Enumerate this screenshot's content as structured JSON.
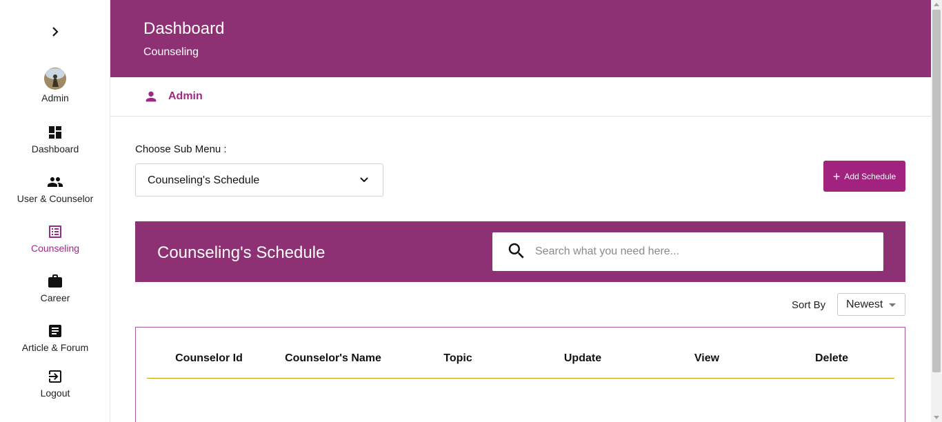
{
  "sidebar": {
    "toggle_icon": "chevron-right-icon",
    "items": [
      {
        "label": "Admin",
        "icon": "avatar"
      },
      {
        "label": "Dashboard",
        "icon": "dashboard-icon"
      },
      {
        "label": "User & Counselor",
        "icon": "people-icon"
      },
      {
        "label": "Counseling",
        "icon": "list-alt-icon",
        "active": true
      },
      {
        "label": "Career",
        "icon": "briefcase-icon"
      },
      {
        "label": "Article & Forum",
        "icon": "article-icon"
      },
      {
        "label": "Logout",
        "icon": "logout-icon"
      }
    ]
  },
  "header": {
    "title": "Dashboard",
    "subtitle": "Counseling"
  },
  "user": {
    "name": "Admin",
    "icon": "person-icon"
  },
  "submenu": {
    "label": "Choose Sub Menu :",
    "selected": "Counseling's Schedule"
  },
  "add_button": {
    "label": "Add Schedule"
  },
  "banner": {
    "title": "Counseling's Schedule",
    "search_placeholder": "Search what you need here..."
  },
  "sort": {
    "label": "Sort By",
    "selected": "Newest"
  },
  "table": {
    "columns": [
      "Counselor Id",
      "Counselor's Name",
      "Topic",
      "Update",
      "View",
      "Delete"
    ],
    "rows": []
  },
  "colors": {
    "primary": "#8e3174",
    "accent": "#a1237f",
    "active_text": "#9c2a84",
    "table_divider": "#c8a400"
  }
}
